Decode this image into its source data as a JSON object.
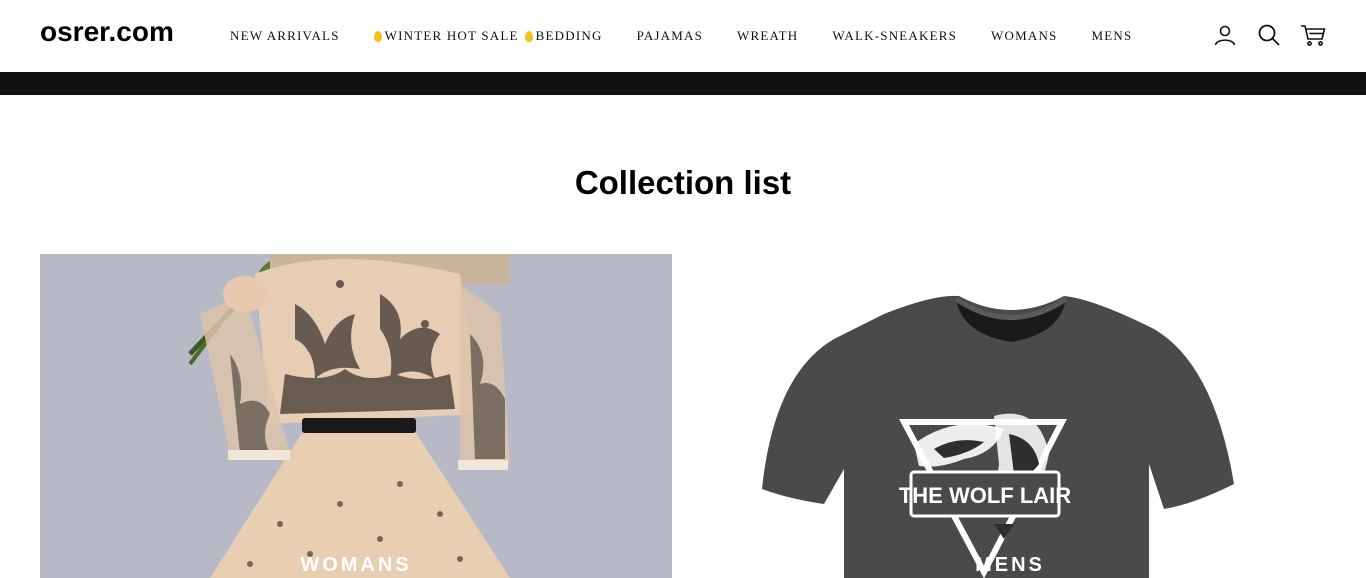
{
  "site": {
    "logo": "osrer.com"
  },
  "nav": {
    "items": [
      {
        "label": "NEW ARRIVALS"
      },
      {
        "label": "WINTER HOT SALE"
      },
      {
        "label": "BEDDING"
      },
      {
        "label": "PAJAMAS"
      },
      {
        "label": "WREATH"
      },
      {
        "label": "WALK-SNEAKERS"
      },
      {
        "label": "WOMANS"
      },
      {
        "label": "MENS"
      }
    ]
  },
  "header_icons": [
    "account-icon",
    "search-icon",
    "cart-icon"
  ],
  "colors": {
    "announcement_bar": "#111111",
    "flame_accent": "#f2c31b",
    "womans_bg": "#b8b9c7"
  },
  "collection": {
    "title": "Collection list",
    "cards": [
      {
        "label": "WOMANS"
      },
      {
        "label": "MENS",
        "shirt_print": "THE WOLF LAIR"
      }
    ]
  }
}
